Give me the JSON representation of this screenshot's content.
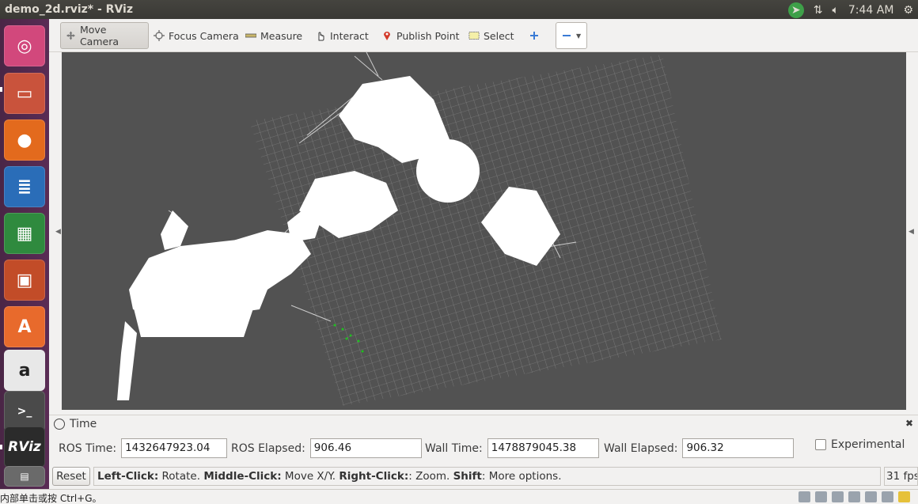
{
  "window": {
    "title": "demo_2d.rviz* - RViz"
  },
  "panel": {
    "time": "7:44 AM"
  },
  "launcher": {
    "items": [
      {
        "name": "ubuntu-dash",
        "color": "#d2487c"
      },
      {
        "name": "files",
        "color": "#c9533c"
      },
      {
        "name": "firefox",
        "color": "#e36a1d"
      },
      {
        "name": "libreoffice-writer",
        "color": "#2a6db8"
      },
      {
        "name": "libreoffice-calc",
        "color": "#2f8a3e"
      },
      {
        "name": "libreoffice-impress",
        "color": "#c24c28"
      },
      {
        "name": "ubuntu-software",
        "color": "#e86a2c"
      },
      {
        "name": "amazon",
        "color": "#333333"
      },
      {
        "name": "terminal",
        "color": "#4a4a4a"
      },
      {
        "name": "rviz",
        "color": "#2b2b2b",
        "label": "RViz"
      }
    ]
  },
  "toolbar": {
    "move_camera": "Move Camera",
    "focus_camera": "Focus Camera",
    "measure": "Measure",
    "interact": "Interact",
    "publish_point": "Publish Point",
    "select": "Select"
  },
  "time_panel": {
    "title": "Time",
    "ros_time_label": "ROS Time:",
    "ros_time": "1432647923.04",
    "ros_elapsed_label": "ROS Elapsed:",
    "ros_elapsed": "906.46",
    "wall_time_label": "Wall Time:",
    "wall_time": "1478879045.38",
    "wall_elapsed_label": "Wall Elapsed:",
    "wall_elapsed": "906.32",
    "experimental_label": "Experimental"
  },
  "status": {
    "reset_label": "Reset",
    "hint_left_click": "Left-Click:",
    "hint_rotate": " Rotate. ",
    "hint_middle_click": "Middle-Click:",
    "hint_move": " Move X/Y. ",
    "hint_right_click": "Right-Click:",
    "hint_zoom": ": Zoom. ",
    "hint_shift": "Shift",
    "hint_more": ": More options.",
    "fps": "31 fps"
  },
  "ime": {
    "text": "内部单击或按 Ctrl+G。"
  },
  "colors": {
    "viewport_bg": "#525252",
    "map_free": "#ffffff",
    "grid": "#a0a0a0"
  }
}
